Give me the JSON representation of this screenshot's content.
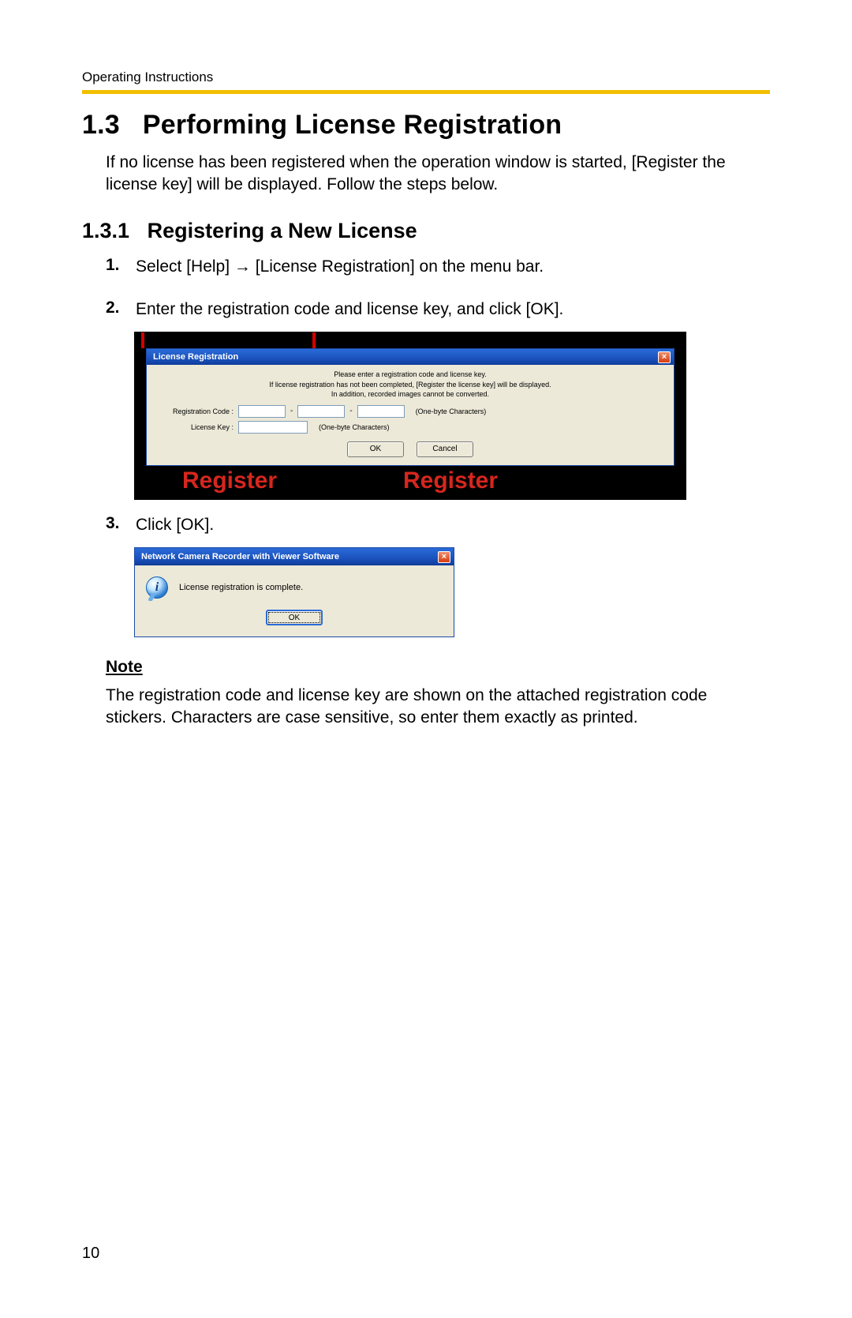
{
  "header": {
    "running": "Operating Instructions"
  },
  "h1": {
    "num": "1.3",
    "title": "Performing License Registration"
  },
  "intro": "If no license has been registered when the operation window is started, [Register the license key] will be displayed. Follow the steps below.",
  "h2": {
    "num": "1.3.1",
    "title": "Registering a New License"
  },
  "steps": {
    "s1": {
      "n": "1.",
      "pre": "Select [Help] ",
      "arrow": "→",
      "post": " [License Registration] on the menu bar."
    },
    "s2": {
      "n": "2.",
      "text": "Enter the registration code and license key, and click [OK]."
    },
    "s3": {
      "n": "3.",
      "text": "Click [OK]."
    }
  },
  "dlg1": {
    "title": "License Registration",
    "hint1": "Please enter a registration code and license key.",
    "hint2": "If license registration has not been completed, [Register the license key] will be displayed.",
    "hint3": "In addition, recorded images cannot be converted.",
    "reg_label": "Registration Code :",
    "key_label": "License Key :",
    "onebyte": "(One-byte Characters)",
    "ok": "OK",
    "cancel": "Cancel",
    "bigword": "Register"
  },
  "dlg2": {
    "title": "Network Camera Recorder with Viewer Software",
    "message": "License registration is complete.",
    "ok": "OK"
  },
  "note": {
    "head": "Note",
    "body": "The registration code and license key are shown on the attached registration code stickers. Characters are case sensitive, so enter them exactly as printed."
  },
  "page_number": "10"
}
